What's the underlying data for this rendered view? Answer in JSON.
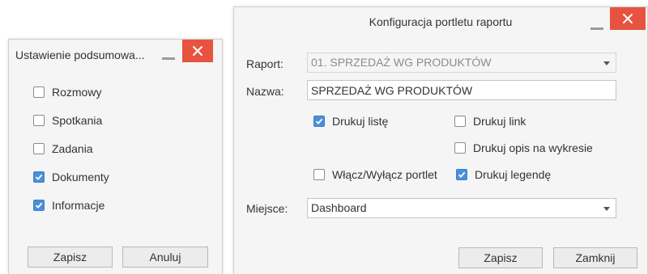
{
  "summary_dialog": {
    "title": "Ustawienie podsumowa...",
    "options": [
      {
        "label": "Rozmowy",
        "checked": false
      },
      {
        "label": "Spotkania",
        "checked": false
      },
      {
        "label": "Zadania",
        "checked": false
      },
      {
        "label": "Dokumenty",
        "checked": true
      },
      {
        "label": "Informacje",
        "checked": true
      }
    ],
    "save_label": "Zapisz",
    "cancel_label": "Anuluj"
  },
  "portlet_dialog": {
    "title": "Konfiguracja portletu raportu",
    "report_label": "Raport:",
    "report_value": "01. SPRZEDAŻ WG PRODUKTÓW",
    "name_label": "Nazwa:",
    "name_value": "SPRZEDAŻ WG PRODUKTÓW",
    "print_list_label": "Drukuj listę",
    "print_list_checked": true,
    "print_link_label": "Drukuj link",
    "print_link_checked": false,
    "print_chart_desc_label": "Drukuj opis na wykresie",
    "print_chart_desc_checked": false,
    "toggle_portlet_label": "Włącz/Wyłącz portlet",
    "toggle_portlet_checked": false,
    "print_legend_label": "Drukuj legendę",
    "print_legend_checked": true,
    "place_label": "Miejsce:",
    "place_value": "Dashboard",
    "save_label": "Zapisz",
    "close_label": "Zamknij"
  },
  "colors": {
    "close_button": "#e8533f",
    "checkbox_checked": "#4a90d9",
    "dialog_background": "#f5f5f5"
  },
  "icons": {
    "minimize": "minimize-icon",
    "close": "close-icon",
    "check": "checkmark-icon",
    "dropdown": "chevron-down-icon"
  }
}
